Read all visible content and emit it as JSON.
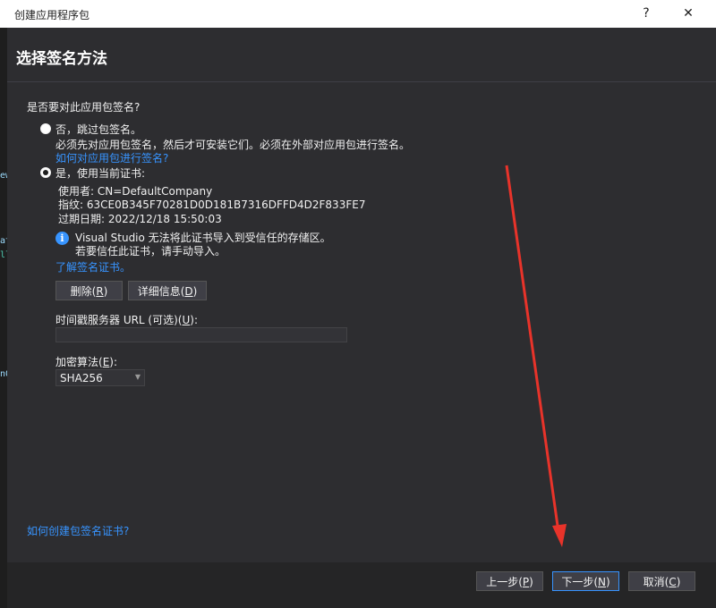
{
  "window": {
    "title": "创建应用程序包",
    "help_glyph": "?",
    "close_glyph": "✕"
  },
  "header": {
    "title": "选择签名方法"
  },
  "question": "是否要对此应用包签名?",
  "option_no": {
    "label": "否，跳过包签名。",
    "desc": "必须先对应用包签名，然后才可安装它们。必须在外部对应用包进行签名。",
    "link": "如何对应用包进行签名?"
  },
  "option_yes": {
    "label": "是，使用当前证书:",
    "issued_to": "使用者: CN=DefaultCompany",
    "thumbprint": "指纹: 63CE0B345F70281D0D181B7316DFFD4D2F833FE7",
    "expires": "过期日期: 2022/12/18 15:50:03"
  },
  "info": {
    "icon": "info-icon",
    "line1": "Visual Studio 无法将此证书导入到受信任的存储区。",
    "line2": "若要信任此证书，请手动导入。"
  },
  "learn_link": "了解签名证书。",
  "buttons": {
    "remove": {
      "text": "删除(",
      "key": "R",
      "end": ")"
    },
    "details": {
      "text": "详细信息(",
      "key": "D",
      "end": ")"
    },
    "prev": {
      "text": "上一步(",
      "key": "P",
      "end": ")"
    },
    "next": {
      "text": "下一步(",
      "key": "N",
      "end": ")"
    },
    "cancel": {
      "text": "取消(",
      "key": "C",
      "end": ")"
    }
  },
  "timestamp": {
    "text": "时间戳服务器 URL (可选)(",
    "key": "U",
    "end": "):",
    "value": ""
  },
  "algorithm": {
    "text": "加密算法(",
    "key": "E",
    "end": "):",
    "selected": "SHA256"
  },
  "bottom_link": "如何创建包签名证书?",
  "side_glyphs": [
    "ew",
    "at",
    "ll",
    "n0"
  ],
  "colors": {
    "accent": "#3794ff",
    "annotation_arrow": "#e8332a",
    "background": "#2d2d30"
  }
}
